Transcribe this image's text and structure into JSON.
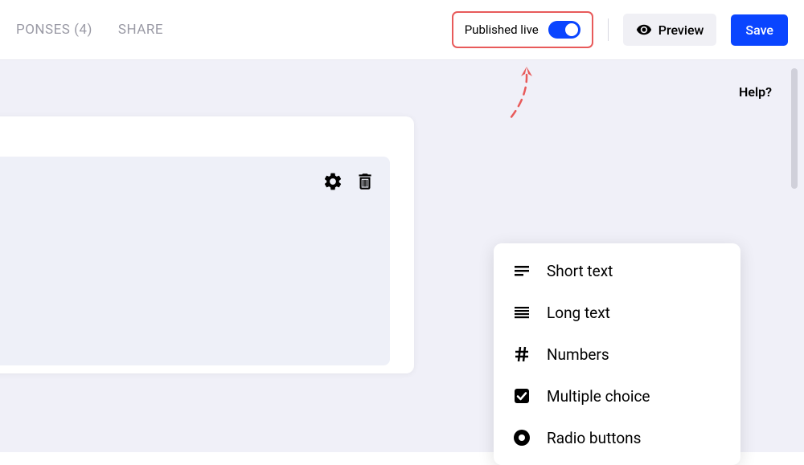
{
  "nav": {
    "responses": "PONSES (4)",
    "share": "SHARE"
  },
  "header": {
    "publish_label": "Published live",
    "preview_label": "Preview",
    "save_label": "Save"
  },
  "canvas": {
    "help_label": "Help?"
  },
  "field_menu": {
    "items": [
      {
        "label": "Short text",
        "icon": "short-text"
      },
      {
        "label": "Long text",
        "icon": "long-text"
      },
      {
        "label": "Numbers",
        "icon": "hash"
      },
      {
        "label": "Multiple choice",
        "icon": "checkbox"
      },
      {
        "label": "Radio buttons",
        "icon": "radio"
      }
    ]
  },
  "colors": {
    "accent": "#0a45ff",
    "highlight": "#e85a5a",
    "canvas_bg": "#f0f0f8"
  }
}
